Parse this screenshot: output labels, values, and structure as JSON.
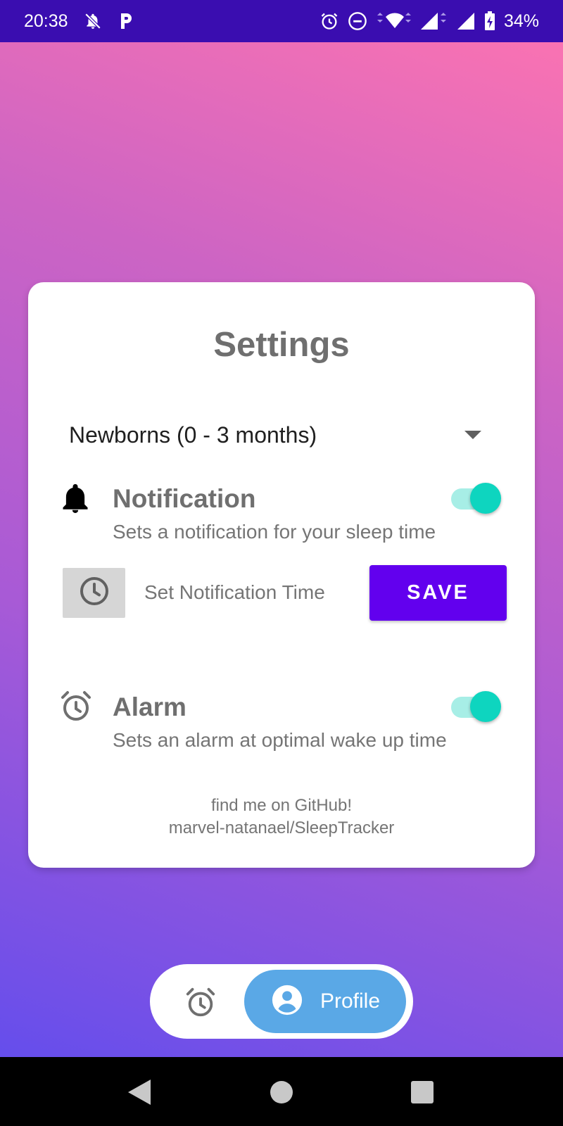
{
  "status_bar": {
    "time": "20:38",
    "battery": "34%",
    "icons": [
      "notifications-off-icon",
      "parking-icon",
      "alarm-icon",
      "do-not-disturb-icon",
      "wifi-icon",
      "signal-icon",
      "signal-icon",
      "battery-charging-icon"
    ]
  },
  "settings": {
    "title": "Settings",
    "age_group": "Newborns (0 - 3 months)",
    "notification": {
      "title": "Notification",
      "description": "Sets a notification for your sleep time",
      "enabled": true
    },
    "notification_time_label": "Set Notification Time",
    "save_label": "SAVE",
    "alarm": {
      "title": "Alarm",
      "description": "Sets an alarm at optimal wake up time",
      "enabled": true
    },
    "github_line1": "find me on GitHub!",
    "github_line2": "marvel-natanael/SleepTracker"
  },
  "bottom_nav": {
    "items": [
      {
        "icon": "alarm-icon",
        "label": ""
      },
      {
        "icon": "account-circle-icon",
        "label": "Profile",
        "active": true
      }
    ]
  },
  "colors": {
    "accent": "#6200ee",
    "toggle_thumb": "#0ed5bf",
    "toggle_track": "#a7eee6",
    "status_bar": "#3a0db0",
    "nav_active": "#5aa8e6"
  }
}
